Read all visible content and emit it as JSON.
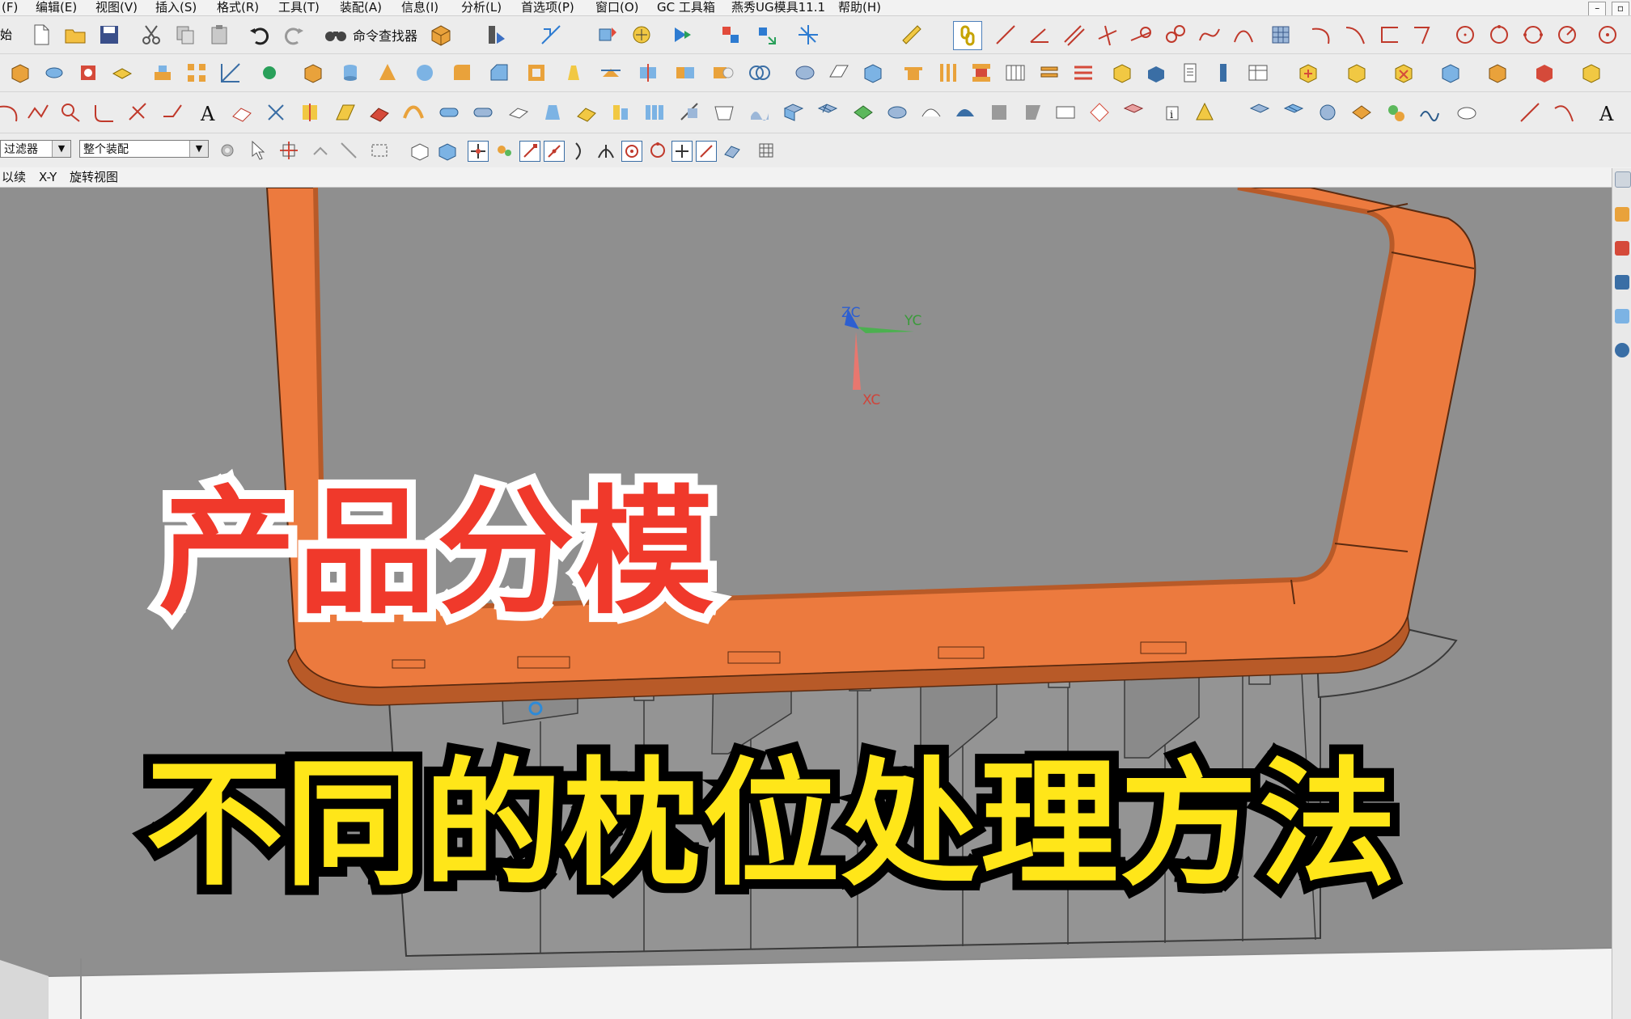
{
  "menu": {
    "items": [
      "(F)",
      "编辑(E)",
      "视图(V)",
      "插入(S)",
      "格式(R)",
      "工具(T)",
      "装配(A)",
      "信息(I)",
      "分析(L)",
      "首选项(P)",
      "窗口(O)",
      "GC 工具箱",
      "燕秀UG模具11.1",
      "帮助(H)"
    ],
    "window_controls": [
      "–",
      "▫"
    ]
  },
  "toolbar": {
    "start_label": "始",
    "command_finder_label": "命令查找器",
    "filter_select": "过滤器",
    "assembly_select": "整个装配"
  },
  "status": {
    "left_text": "以续",
    "view_axes": "X-Y",
    "view_mode": "旋转视图"
  },
  "viewport": {
    "wcs_labels": {
      "z": "ZC",
      "y": "YC",
      "x": "XC"
    },
    "colors": {
      "background": "#8f8f8f",
      "product_rim": "#ec7a3e",
      "product_rim_dark": "#b85a28",
      "inserts": "#949494",
      "edges": "#3a3a3a",
      "floor": "#f3f3f3"
    }
  },
  "overlay": {
    "title_top": "产品分模",
    "title_bottom": "不同的枕位处理方法",
    "title_top_color": "#f0392b",
    "title_bottom_color": "#ffe619"
  }
}
